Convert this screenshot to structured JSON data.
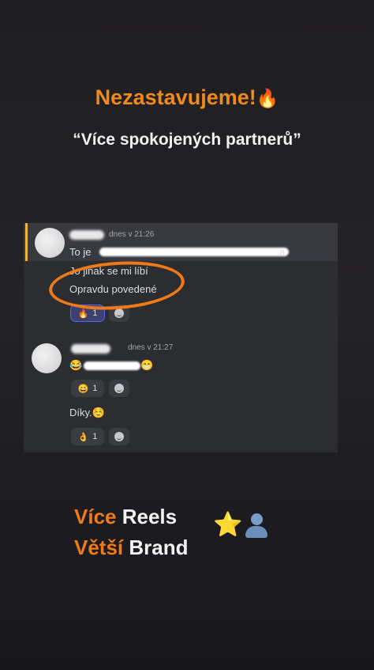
{
  "headline": {
    "text": "Nezastavujeme!",
    "emoji": "🔥"
  },
  "subtitle": "“Více spokojených partnerů”",
  "chat": {
    "msg1": {
      "username": "Marius",
      "timestamp": "dnes v 21:26",
      "reply_preview_start": "To je",
      "reply_preview_end": "a",
      "lines": [
        "Jo jinak se mi líbí",
        "Opravdu povedené"
      ],
      "reactions": [
        {
          "emoji": "🔥",
          "count": "1"
        }
      ]
    },
    "msg2": {
      "username": "JAKUB",
      "timestamp": "dnes v 21:27",
      "line1_emoji_left": "😂",
      "line1_emoji_right": "😁",
      "reaction1": {
        "emoji": "😄",
        "count": "1"
      },
      "line2": "Díky.",
      "line2_emoji": "☺️",
      "reaction2": {
        "emoji": "👌",
        "count": "1"
      }
    }
  },
  "promo": {
    "line1_highlight": "Více",
    "line1_rest": "Reels",
    "line2_highlight": "Větší",
    "line2_rest": "Brand",
    "emoji_star": "⭐"
  },
  "colors": {
    "accent": "#f07a1a",
    "discord_bg": "#2b2d31",
    "reaction_active": "#5865f2"
  }
}
